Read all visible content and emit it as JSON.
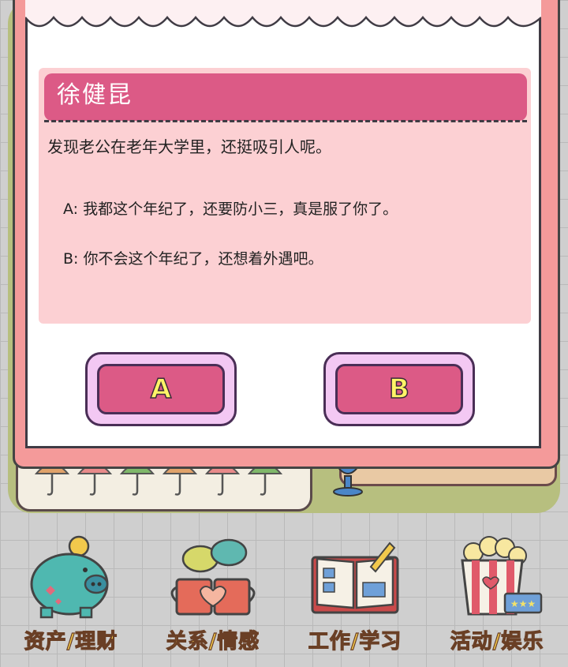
{
  "dialog": {
    "speaker_name": "徐健昆",
    "question": "发现老公在老年大学里，还挺吸引人呢。",
    "option_a": "A: 我都这个年纪了，还要防小三，真是服了你了。",
    "option_b": "B: 你不会这个年纪了，还想着外遇吧。",
    "button_a_label": "A",
    "button_b_label": "B"
  },
  "nav": {
    "items": [
      {
        "label": "资产/理财",
        "icon": "piggy-bank-icon"
      },
      {
        "label": "关系/情感",
        "icon": "couple-mugs-icon"
      },
      {
        "label": "工作/学习",
        "icon": "open-book-icon"
      },
      {
        "label": "活动/娱乐",
        "icon": "popcorn-icon"
      }
    ]
  },
  "colors": {
    "accent_pink": "#dc5a86",
    "card_pink": "#fcd0d3",
    "button_text_yellow": "#fff467",
    "nav_label_yellow": "#f2c94c"
  }
}
